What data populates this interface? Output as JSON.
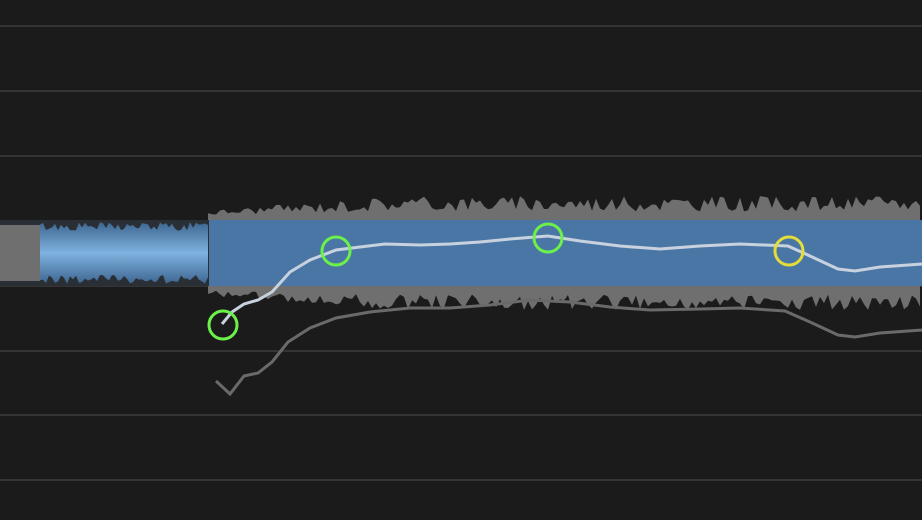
{
  "theme": {
    "background": "#1b1b1b",
    "grid_line": "#343434",
    "note_blue": "#4a76a6",
    "note_highlight": "#7fb2e0",
    "waveform_gray": "#6f6f6f",
    "pitch_curve_light": "#c7d2de",
    "pitch_curve_dark": "#6a6a6a",
    "handle_active": "#6cf04a",
    "handle_selected": "#e3dc3a"
  },
  "pitch_editor": {
    "notes": [
      {
        "name": "note-blob-1",
        "state": "unselected"
      },
      {
        "name": "note-blob-2",
        "state": "selected"
      }
    ],
    "handles": [
      {
        "name": "pitch-handle-start",
        "color_role": "active"
      },
      {
        "name": "pitch-handle-1",
        "color_role": "active"
      },
      {
        "name": "pitch-handle-2",
        "color_role": "active"
      },
      {
        "name": "pitch-handle-end",
        "color_role": "selected"
      }
    ]
  }
}
